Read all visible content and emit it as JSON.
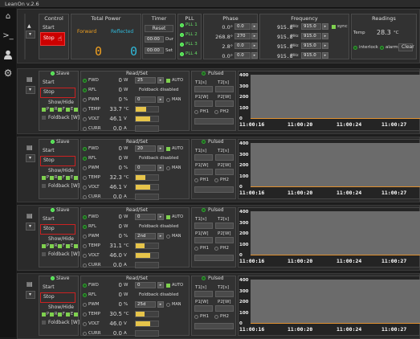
{
  "app": {
    "title": "LeanOn v.2.6"
  },
  "colors": {
    "accent_red": "#cc0000",
    "led_green": "#52d652",
    "forward": "#f0a020",
    "reflected": "#30b8d8",
    "gauge": "#e6c44a",
    "chart_line": "#e09030"
  },
  "sidebar": {
    "icons": [
      "home-icon",
      "terminal-icon",
      "user-icon",
      "gear-icon"
    ]
  },
  "control": {
    "title": "Control",
    "start": "Start",
    "stop": "Stop"
  },
  "total_power": {
    "title": "Total Power",
    "forward_label": "Forward",
    "reflected_label": "Reflected",
    "forward_value": "0",
    "reflected_value": "0"
  },
  "timer": {
    "title": "Timer",
    "reset": "Reset",
    "dur_value": "00:00",
    "dur_label": "Dur",
    "set_value": "00:00",
    "set_label": "Set"
  },
  "pll": {
    "title": "PLL",
    "items": [
      "PLL 1",
      "PLL 2",
      "PLL 3",
      "PLL 4"
    ]
  },
  "phase": {
    "title": "Phase",
    "rows": [
      {
        "value": "0.0°",
        "set": "0.0"
      },
      {
        "value": "268.8°",
        "set": "270"
      },
      {
        "value": "2.8°",
        "set": "0.0"
      },
      {
        "value": "0.0°",
        "set": "0.0"
      }
    ]
  },
  "frequency": {
    "title": "Frequency",
    "unit": "MHz",
    "sync": "sync",
    "rows": [
      {
        "value": "915.8",
        "set": "915.0"
      },
      {
        "value": "915.8",
        "set": "915.0"
      },
      {
        "value": "915.8",
        "set": "915.0"
      },
      {
        "value": "915.8",
        "set": "915.0"
      }
    ]
  },
  "readings": {
    "title": "Readings",
    "temp_label": "Temp",
    "temp_value": "28.3",
    "temp_unit": "°C",
    "interlock": "interlock",
    "alarm": "alarm",
    "clear": "Clear"
  },
  "module_labels": {
    "slave": "Slave",
    "start": "Start",
    "stop": "Stop",
    "showhide": "Show/Hide",
    "toggles": [
      "P",
      "R",
      "F",
      "E"
    ],
    "foldback": "Foldback [W]",
    "readset": "Read/Set",
    "pulsed": "Pulsed",
    "fwd": "FWD",
    "rfl": "RFL",
    "pwm": "PWM",
    "temp": "TEMP",
    "volt": "VOLT",
    "curr": "CURR",
    "unit_w": "W",
    "unit_pct": "%",
    "unit_c": "°C",
    "unit_v": "V",
    "unit_a": "A",
    "auto": "AUTO",
    "foldback_disabled": "Foldback disabled",
    "man": "MAN",
    "t1": "T1[s]",
    "t2": "T2[s]",
    "p1": "P1[W]",
    "p2": "P2[W]",
    "ph1": "PH1",
    "ph2": "PH2"
  },
  "modules": [
    {
      "fwd": "0",
      "fwd_set": "25",
      "pwm": "0",
      "pwm_set": "0",
      "temp": "33.7",
      "temp_frac": 0.45,
      "volt": "46.1",
      "volt_frac": 0.65,
      "curr": "0.0",
      "curr_frac": 0.0
    },
    {
      "fwd": "0",
      "fwd_set": "20",
      "pwm": "0",
      "pwm_set": "0",
      "temp": "32.3",
      "temp_frac": 0.42,
      "volt": "46.1",
      "volt_frac": 0.65,
      "curr": "0.0",
      "curr_frac": 0.0
    },
    {
      "fwd": "0",
      "fwd_set": "0",
      "pwm": "0",
      "pwm_set": "2nd",
      "temp": "31.1",
      "temp_frac": 0.4,
      "volt": "46.0",
      "volt_frac": 0.65,
      "curr": "0.0",
      "curr_frac": 0.0
    },
    {
      "fwd": "0",
      "fwd_set": "0",
      "pwm": "0",
      "pwm_set": "25d",
      "temp": "30.5",
      "temp_frac": 0.38,
      "volt": "46.0",
      "volt_frac": 0.65,
      "curr": "0.0",
      "curr_frac": 0.0
    }
  ],
  "chart": {
    "yticks": [
      "400",
      "300",
      "200",
      "100",
      "0"
    ],
    "xticks": [
      "11:00:16",
      "11:00:20",
      "11:00:24",
      "11:00:27"
    ]
  }
}
